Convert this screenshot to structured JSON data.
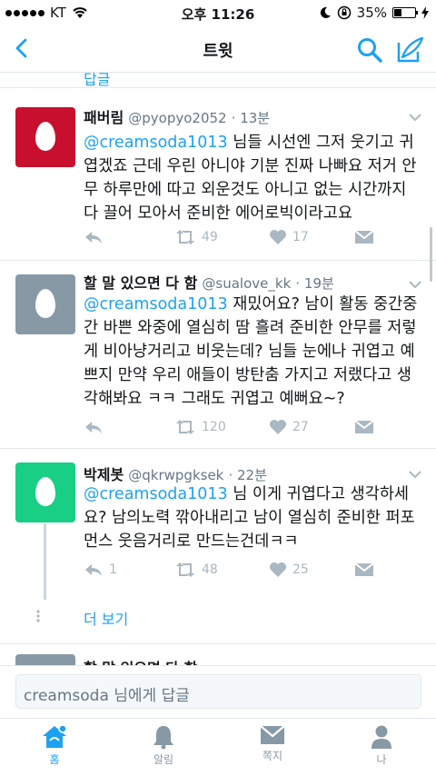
{
  "status": {
    "carrier": "KT",
    "time": "오후 11:26",
    "battery": "35%"
  },
  "nav": {
    "title": "트윗"
  },
  "prev_link": "답글",
  "tweets": [
    {
      "name": "패버림",
      "handle": "@pyopyo2052",
      "time": "· 13분",
      "mention": "@creamsoda1013",
      "text": " 님들 시선엔 그저 웃기고 귀엽겠죠 근데 우린 아니야 기분 진짜 나빠요 저거 안무 하루만에 따고 외운것도 아니고 없는 시간까지 다 끌어 모아서 준비한 에어로빅이라고요",
      "reply": "",
      "retweets": "49",
      "likes": "17",
      "avatar_color": "#c8102e"
    },
    {
      "name": "할 말 있으면 다 함",
      "handle": "@sualove_kk",
      "time": "· 19분",
      "mention": "@creamsoda1013",
      "text": " 재밌어요? 남이 활동 중간중간 바쁜 와중에 열심히 땀 흘려 준비한 안무를 저렇게 비아냥거리고 비웃는데? 님들 눈에나 귀엽고 예쁘지 만약 우리 애들이 방탄춤 가지고 저랬다고 생각해봐요 ㅋㅋ 그래도 귀엽고 예뻐요~?",
      "reply": "",
      "retweets": "120",
      "likes": "27",
      "avatar_color": "#8899a6"
    },
    {
      "name": "박제봇",
      "handle": "@qkrwpgksek",
      "time": "· 22분",
      "mention": "@creamsoda1013",
      "text": " 님 이게 귀엽다고 생각하세요? 남의노력 깎아내리고 남이 열심히 준비한 퍼포먼스 웃음거리로 만드는건데ㅋㅋ",
      "reply": "1",
      "retweets": "48",
      "likes": "25",
      "avatar_color": "#19cf86"
    }
  ],
  "more_label": "더 보기",
  "peek_name": "할 말 있으면 다 함",
  "reply_placeholder": "creamsoda 님에게 답글",
  "tabs": [
    {
      "label": "홈",
      "icon": "home-icon"
    },
    {
      "label": "알림",
      "icon": "bell-icon"
    },
    {
      "label": "쪽지",
      "icon": "envelope-icon"
    },
    {
      "label": "나",
      "icon": "person-icon"
    }
  ],
  "colors": {
    "accent": "#1da1f2",
    "muted": "#aab8c2"
  }
}
